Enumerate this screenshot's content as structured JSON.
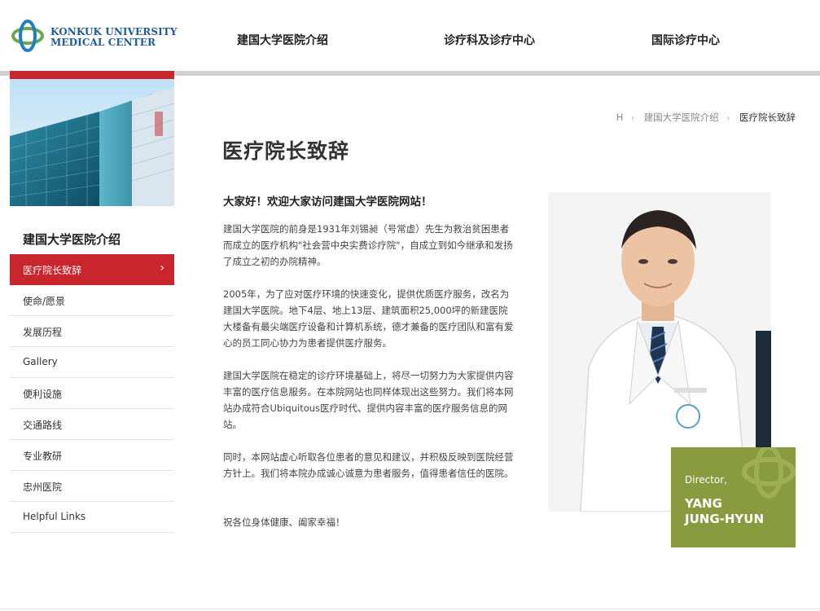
{
  "header": {
    "logo": {
      "line1": "KONKUK UNIVERSITY",
      "line2": "MEDICAL CENTER"
    },
    "nav": [
      {
        "label": "建国大学医院介绍"
      },
      {
        "label": "诊疗科及诊疗中心"
      },
      {
        "label": "国际诊疗中心"
      }
    ]
  },
  "sidebar": {
    "title": "建国大学医院介绍",
    "items": [
      {
        "label": "医疗院长致辞",
        "active": true
      },
      {
        "label": "使命/愿景"
      },
      {
        "label": "发展历程"
      },
      {
        "label": "Gallery"
      },
      {
        "label": "便利设施"
      },
      {
        "label": "交通路线"
      },
      {
        "label": "专业教研"
      },
      {
        "label": "忠州医院"
      },
      {
        "label": "Helpful Links"
      }
    ],
    "active_chevron": "›"
  },
  "breadcrumb": {
    "home": "H",
    "level1": "建国大学医院介绍",
    "current": "医疗院长致辞",
    "separator": "›"
  },
  "page": {
    "title": "医疗院长致辞",
    "greeting": "大家好！欢迎大家访问建国大学医院网站！",
    "paragraphs": [
      "建国大学医院的前身是1931年刘锡昶（号常虚）先生为救治贫困患者而成立的医疗机构\"社会营中央实费诊疗院\"，自成立到如今继承和发扬了成立之初的办院精神。",
      "2005年，为了应对医疗环境的快速变化，提供优质医疗服务，改名为建国大学医院。地下4层、地上13层、建筑面积25,000坪的新建医院大楼备有最尖端医疗设备和计算机系统，德才兼备的医疗团队和富有爱心的员工同心协力为患者提供医疗服务。",
      "建国大学医院在稳定的诊疗环境基础上，将尽一切努力为大家提供内容丰富的医疗信息服务。在本院网站也同样体现出这些努力。我们将本网站办成符合Ubiquitous医疗时代、提供内容丰富的医疗服务信息的网站。",
      "同时，本网站虚心听取各位患者的意见和建议，并积极反映到医院经营方针上。我们将本院办成诚心诚意为患者服务，值得患者信任的医院。",
      "祝各位身体健康、阖家幸福！"
    ]
  },
  "director": {
    "role": "Director,",
    "name_line1": "YANG",
    "name_line2": "JUNG-HYUN"
  },
  "colors": {
    "accent_red": "#c8262c",
    "olive": "#8a9a3e",
    "logo_blue": "#1f5a99",
    "logo_green": "#6aa84f"
  }
}
